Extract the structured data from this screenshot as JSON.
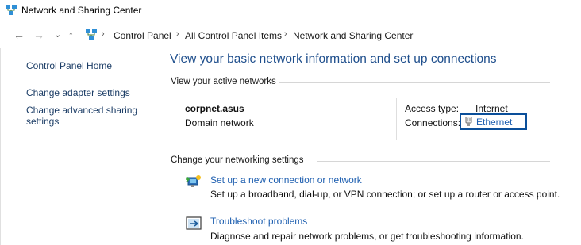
{
  "window": {
    "title": "Network and Sharing Center",
    "icon": "network-center-icon"
  },
  "navigation": {
    "back": "←",
    "forward": "→",
    "recent": "⌄",
    "up": "↑",
    "separator": "›",
    "breadcrumb": [
      "Control Panel",
      "All Control Panel Items",
      "Network and Sharing Center"
    ]
  },
  "sidebar": {
    "items": [
      {
        "label": "Control Panel Home"
      },
      {
        "label": "Change adapter settings"
      },
      {
        "label_line1": "Change advanced sharing",
        "label_line2": "settings"
      }
    ]
  },
  "main": {
    "title": "View your basic network information and set up connections",
    "active_networks": {
      "header": "View your active networks",
      "network_name": "corpnet.asus",
      "network_type": "Domain network",
      "access_type_label": "Access type:",
      "access_type_value": "Internet",
      "connections_label": "Connections:",
      "connection_name": "Ethernet",
      "connection_icon": "ethernet-icon"
    },
    "settings": {
      "header": "Change your networking settings",
      "tasks": [
        {
          "icon": "new-connection-icon",
          "title": "Set up a new connection or network",
          "description": "Set up a broadband, dial-up, or VPN connection; or set up a router or access point."
        },
        {
          "icon": "troubleshoot-icon",
          "title": "Troubleshoot problems",
          "description": "Diagnose and repair network problems, or get troubleshooting information."
        }
      ]
    }
  },
  "colors": {
    "link": "#1e5fb0",
    "title": "#1e4e8c",
    "highlight_border": "#0b4f9a"
  }
}
